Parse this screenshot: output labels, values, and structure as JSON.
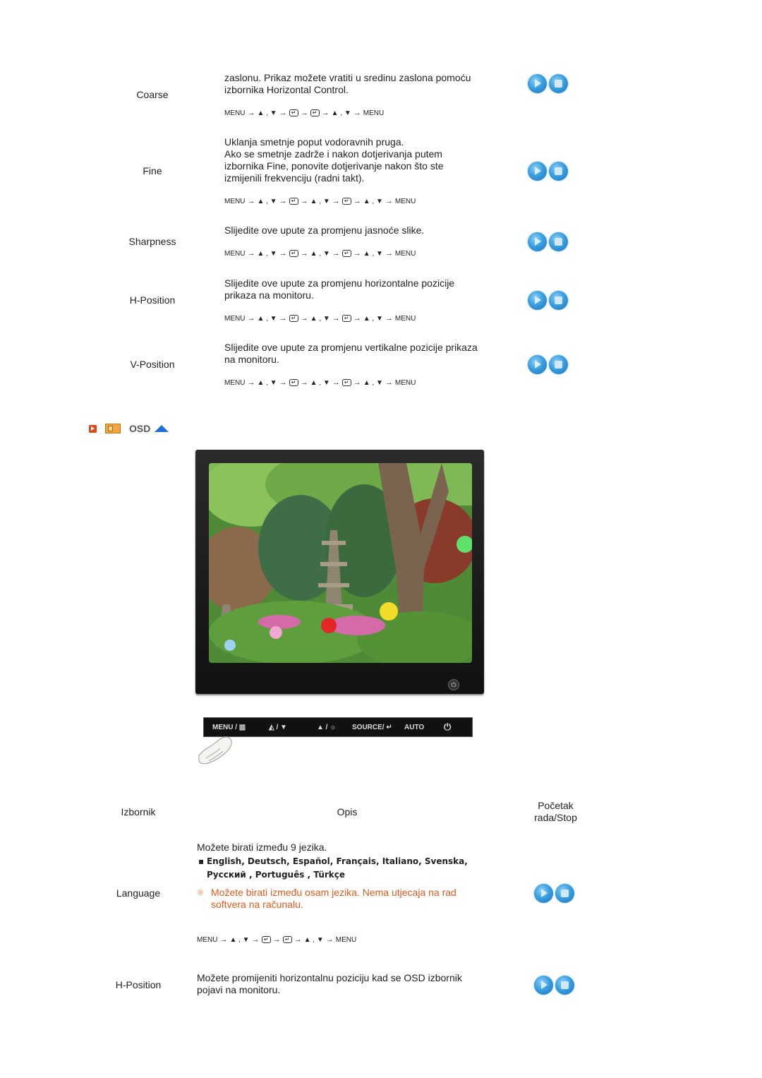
{
  "rows_top": [
    {
      "label": "Coarse",
      "desc": [
        "zaslonu. Prikaz možete vratiti u sredinu zaslona pomoću",
        "izbornika Horizontal Control."
      ],
      "sequence": [
        "MENU",
        "→",
        "▲ , ▼",
        "→",
        "ENTER",
        "→",
        "ENTER",
        "→",
        "▲ , ▼",
        "→",
        "MENU"
      ]
    },
    {
      "label": "Fine",
      "desc": [
        "Uklanja smetnje poput vodoravnih pruga.",
        "Ako se smetnje zadrže i nakon dotjerivanja putem",
        "izbornika Fine, ponovite dotjerivanje nakon što ste",
        "izmijenili frekvenciju (radni takt)."
      ],
      "sequence": [
        "MENU",
        "→",
        "▲ , ▼",
        "→",
        "ENTER",
        "→",
        "▲ , ▼",
        "→",
        "ENTER",
        "→",
        "▲ , ▼",
        "→",
        "MENU"
      ]
    },
    {
      "label": "Sharpness",
      "desc": [
        "Slijedite ove upute za promjenu jasnoće slike."
      ],
      "sequence": [
        "MENU",
        "→",
        "▲ , ▼",
        "→",
        "ENTER",
        "→",
        "▲ , ▼",
        "→",
        "ENTER",
        "→",
        "▲ , ▼",
        "→",
        "MENU"
      ]
    },
    {
      "label": "H-Position",
      "desc": [
        "Slijedite ove upute za promjenu horizontalne pozicije",
        "prikaza na monitoru."
      ],
      "sequence": [
        "MENU",
        "→",
        "▲ , ▼",
        "→",
        "ENTER",
        "→",
        "▲ , ▼",
        "→",
        "ENTER",
        "→",
        "▲ , ▼",
        "→",
        "MENU"
      ]
    },
    {
      "label": "V-Position",
      "desc": [
        "Slijedite ove upute za promjenu vertikalne pozicije prikaza",
        "na monitoru."
      ],
      "sequence": [
        "MENU",
        "→",
        "▲ , ▼",
        "→",
        "ENTER",
        "→",
        "▲ , ▼",
        "→",
        "ENTER",
        "→",
        "▲ , ▼",
        "→",
        "MENU"
      ]
    }
  ],
  "osd_section": {
    "title": "OSD",
    "icons": [
      "play-marker-icon",
      "osd-panel-icon",
      "scroll-up-icon"
    ]
  },
  "monitor": {
    "image_description": "Garden with pagoda, trees and paper lanterns",
    "power_icon": "power-icon"
  },
  "control_bar": {
    "buttons": [
      "MENU / ▥",
      "◭ / ▼",
      "▲ / ☼",
      "SOURCE/ ↵",
      "AUTO",
      "⏻"
    ]
  },
  "table_header": {
    "col1": "Izbornik",
    "col2": "Opis",
    "col3_line1": "Početak",
    "col3_line2": "rada/Stop"
  },
  "rows_bottom": [
    {
      "label": "Language",
      "desc": "Možete birati između 9 jezika.",
      "languages_line1": "English, Deutsch, Español, Français,  Italiano, Svenska,",
      "languages_line2": "Русский , Português , Türkçe",
      "note_symbol": "※",
      "note": [
        "Možete birati između osam jezika. Nema utjecaja na rad",
        "softvera na računalu."
      ],
      "sequence": [
        "MENU",
        "→",
        "▲ , ▼",
        "→",
        "ENTER",
        "→",
        "ENTER",
        "→",
        "▲ , ▼",
        "→",
        "MENU"
      ]
    },
    {
      "label": "H-Position",
      "desc": [
        "Možete promijeniti horizontalnu poziciju kad se OSD izbornik",
        "pojavi na monitoru."
      ]
    }
  ],
  "colors": {
    "note": "#e05a1c",
    "button_blue": "#2a8bd6",
    "osd_arrow": "#1e6fd9",
    "osd_marker": "#e04a1a"
  }
}
